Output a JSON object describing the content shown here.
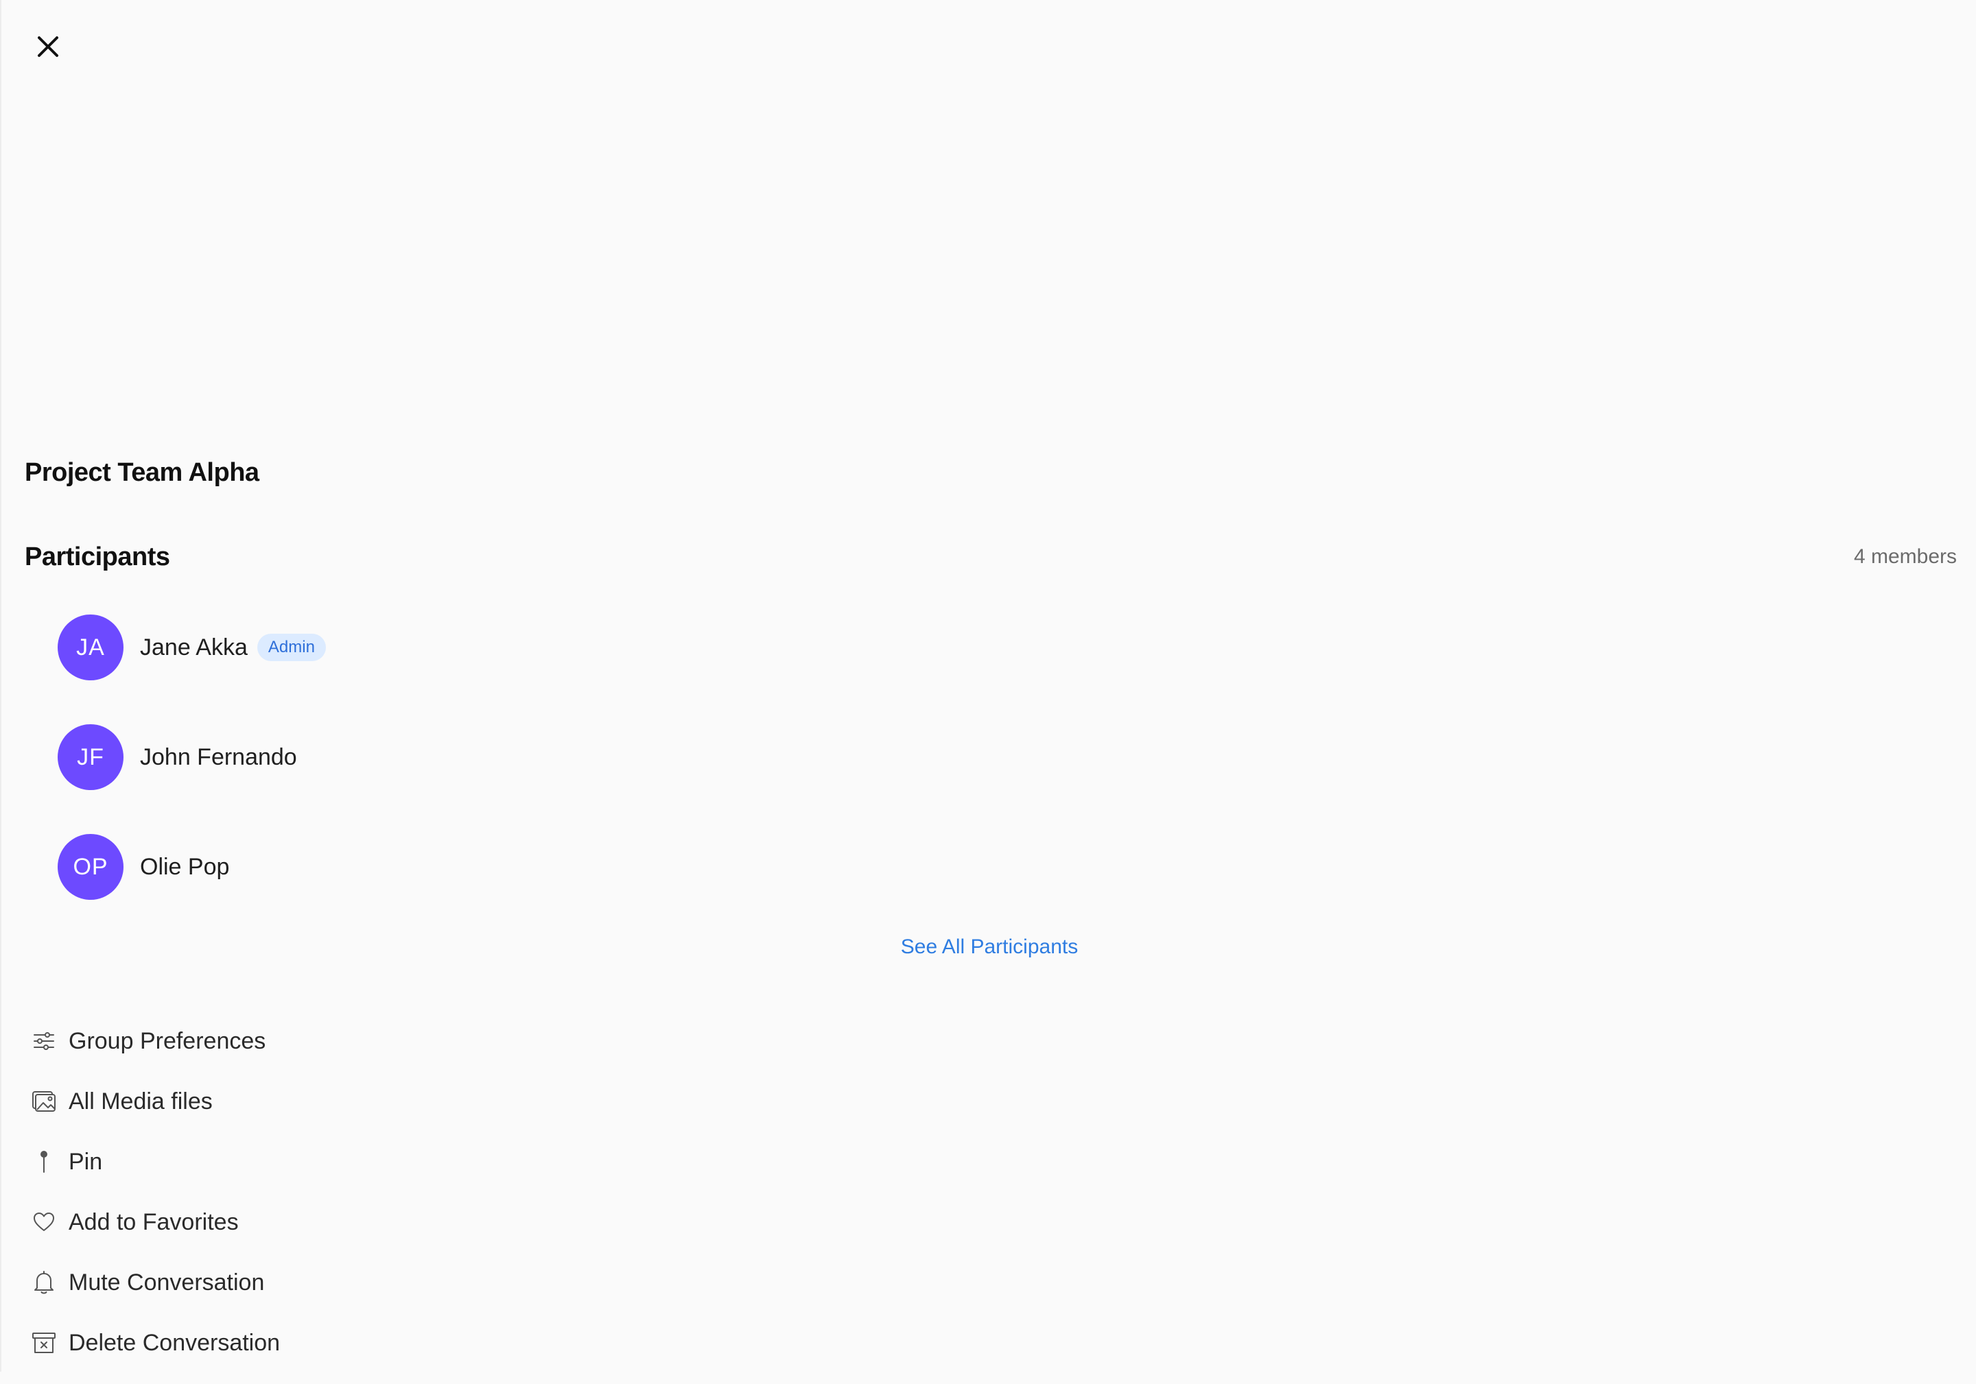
{
  "group": {
    "title": "Project Team Alpha"
  },
  "participants": {
    "title": "Participants",
    "count_label": "4 members",
    "items": [
      {
        "initials": "JA",
        "name": "Jane Akka",
        "badge": "Admin"
      },
      {
        "initials": "JF",
        "name": "John Fernando"
      },
      {
        "initials": "OP",
        "name": "Olie Pop"
      }
    ],
    "see_all_label": "See All Participants"
  },
  "menu": {
    "items": [
      {
        "label": "Group Preferences",
        "icon": "sliders-icon"
      },
      {
        "label": "All Media files",
        "icon": "media-icon"
      },
      {
        "label": "Pin",
        "icon": "pin-icon"
      },
      {
        "label": "Add to Favorites",
        "icon": "heart-icon"
      },
      {
        "label": "Mute Conversation",
        "icon": "bell-icon"
      },
      {
        "label": "Delete Conversation",
        "icon": "archive-icon"
      }
    ]
  },
  "colors": {
    "background": "#fafafa",
    "avatar": "#6d4aff",
    "link": "#2f7de1",
    "badge_bg": "#dcebff",
    "badge_text": "#2e6fd9"
  }
}
